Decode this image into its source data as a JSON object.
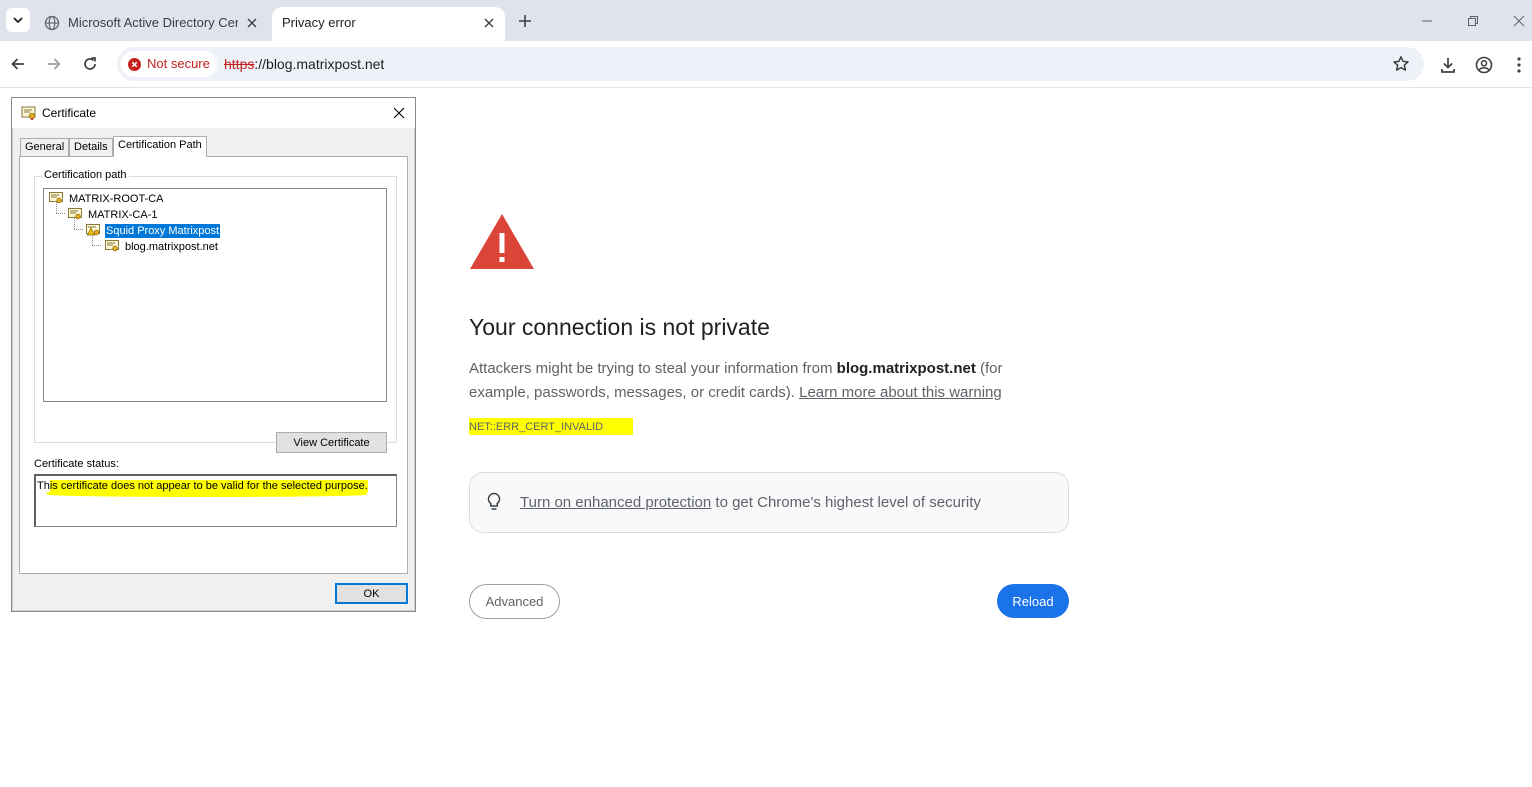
{
  "browser": {
    "tabs": [
      {
        "title": "Microsoft Active Directory Certi",
        "active": false
      },
      {
        "title": "Privacy error",
        "active": true
      }
    ],
    "omnibox": {
      "security_chip": "Not secure",
      "url_scheme": "https",
      "url_rest": "://blog.matrixpost.net"
    }
  },
  "error_page": {
    "title": "Your connection is not private",
    "desc_before": "Attackers might be trying to steal your information from ",
    "desc_host": "blog.matrixpost.net",
    "desc_after": " (for example, passwords, messages, or credit cards). ",
    "learn_more": "Learn more about this warning",
    "error_code": "NET::ERR_CERT_INVALID",
    "enhanced_link": "Turn on enhanced protection",
    "enhanced_rest": " to get Chrome's highest level of security",
    "advanced_label": "Advanced",
    "reload_label": "Reload",
    "colors": {
      "error_red": "#db4437",
      "reload_blue": "#1a73e8",
      "highlight": "#ffff00"
    }
  },
  "cert_dialog": {
    "title": "Certificate",
    "tabs": [
      "General",
      "Details",
      "Certification Path"
    ],
    "active_tab": "Certification Path",
    "group_label": "Certification path",
    "path": [
      {
        "label": "MATRIX-ROOT-CA",
        "level": 0,
        "selected": false
      },
      {
        "label": "MATRIX-CA-1",
        "level": 1,
        "selected": false
      },
      {
        "label": "Squid Proxy Matrixpost",
        "level": 2,
        "selected": true
      },
      {
        "label": "blog.matrixpost.net",
        "level": 3,
        "selected": false
      }
    ],
    "view_certificate_label": "View Certificate",
    "status_label": "Certificate status:",
    "status_first": "Th",
    "status_rest": "is certificate does not appear to be valid for the selected purpose.",
    "ok_label": "OK"
  }
}
